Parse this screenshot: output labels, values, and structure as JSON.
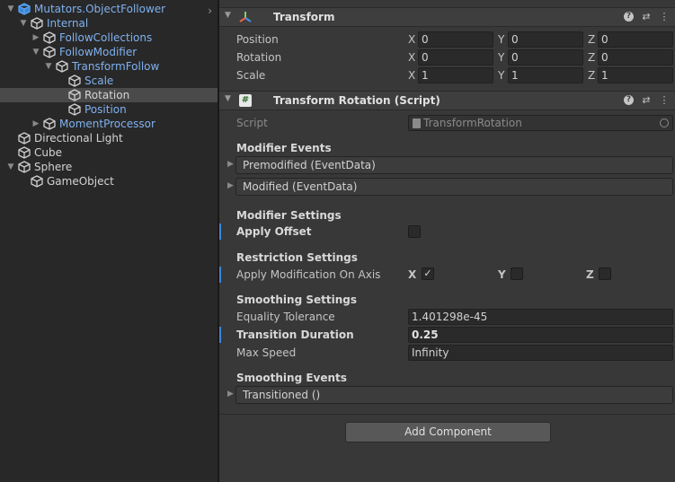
{
  "hierarchy": {
    "items": [
      {
        "label": "Mutators.ObjectFollower",
        "color": "blue",
        "fold": "open",
        "icon": "prefab-cube-icon"
      },
      {
        "label": "Internal",
        "color": "blue",
        "fold": "open",
        "icon": "cube-icon"
      },
      {
        "label": "FollowCollections",
        "color": "blue",
        "fold": "closed",
        "icon": "cube-icon"
      },
      {
        "label": "FollowModifier",
        "color": "blue",
        "fold": "open",
        "icon": "cube-icon"
      },
      {
        "label": "TransformFollow",
        "color": "blue",
        "fold": "open",
        "icon": "cube-icon"
      },
      {
        "label": "Scale",
        "color": "blue",
        "fold": "none",
        "icon": "cube-icon"
      },
      {
        "label": "Rotation",
        "color": "white",
        "fold": "none",
        "icon": "cube-icon",
        "selected": true
      },
      {
        "label": "Position",
        "color": "blue",
        "fold": "none",
        "icon": "cube-icon"
      },
      {
        "label": "MomentProcessor",
        "color": "blue",
        "fold": "closed",
        "icon": "cube-icon"
      },
      {
        "label": "Directional Light",
        "color": "white",
        "fold": "none",
        "icon": "cube-icon"
      },
      {
        "label": "Cube",
        "color": "white",
        "fold": "none",
        "icon": "cube-icon"
      },
      {
        "label": "Sphere",
        "color": "white",
        "fold": "open",
        "icon": "cube-icon"
      },
      {
        "label": "GameObject",
        "color": "white",
        "fold": "none",
        "icon": "cube-icon"
      }
    ],
    "root_arrow": "›"
  },
  "transform": {
    "title": "Transform",
    "rows": [
      {
        "label": "Position",
        "x": "0",
        "y": "0",
        "z": "0"
      },
      {
        "label": "Rotation",
        "x": "0",
        "y": "0",
        "z": "0"
      },
      {
        "label": "Scale",
        "x": "1",
        "y": "1",
        "z": "1"
      }
    ],
    "axis_x": "X",
    "axis_y": "Y",
    "axis_z": "Z"
  },
  "script_component": {
    "title": "Transform Rotation (Script)",
    "icon_glyph": "#",
    "script_label": "Script",
    "script_value": "TransformRotation",
    "modifier_events_title": "Modifier Events",
    "premodified": "Premodified (EventData)",
    "modified": "Modified (EventData)",
    "modifier_settings_title": "Modifier Settings",
    "apply_offset_label": "Apply Offset",
    "apply_offset_checked": false,
    "restriction_settings_title": "Restriction Settings",
    "apply_axis_label": "Apply Modification On Axis",
    "axis_x": "X",
    "axis_y": "Y",
    "axis_z": "Z",
    "axis_x_checked": true,
    "axis_y_checked": false,
    "axis_z_checked": false,
    "smoothing_settings_title": "Smoothing Settings",
    "equality_label": "Equality Tolerance",
    "equality_value": "1.401298e-45",
    "transition_label": "Transition Duration",
    "transition_value": "0.25",
    "max_speed_label": "Max Speed",
    "max_speed_value": "Infinity",
    "smoothing_events_title": "Smoothing Events",
    "transitioned": "Transitioned ()"
  },
  "add_component_label": "Add Component",
  "icons": {
    "help": "?",
    "presets": "⇄",
    "menu": "⋮",
    "check": "✓"
  },
  "colors": {
    "accent_blue": "#7fb1f0",
    "marker": "#3b86d9",
    "panel": "#383838",
    "hierarchy": "#282828"
  }
}
